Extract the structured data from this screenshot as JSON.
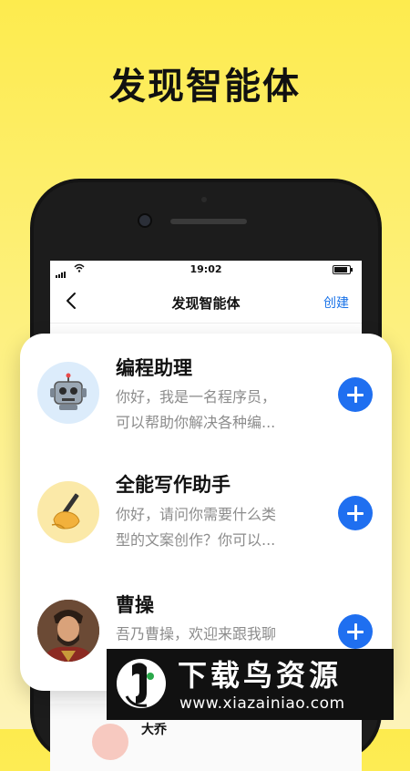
{
  "headline": "发现智能体",
  "statusbar": {
    "time": "19:02"
  },
  "navbar": {
    "title": "发现智能体",
    "create_label": "创建"
  },
  "agents": [
    {
      "name": "编程助理",
      "desc_line1": "你好，我是一名程序员，",
      "desc_line2": "可以帮助你解决各种编...",
      "icon": "robot-icon"
    },
    {
      "name": "全能写作助手",
      "desc_line1": "你好，请问你需要什么类",
      "desc_line2": "型的文案创作？你可以...",
      "icon": "writing-hand-icon"
    },
    {
      "name": "曹操",
      "desc_line1": "吾乃曹操，欢迎来跟我聊",
      "desc_line2": "",
      "icon": "portrait-avatar"
    }
  ],
  "ghost_item": {
    "name": "大乔"
  },
  "watermark": {
    "title": "下载鸟资源",
    "url": "www.xiazainiao.com"
  },
  "colors": {
    "accent": "#1f6ff0",
    "link": "#1a73e8",
    "background_top": "#fdeb4e"
  }
}
